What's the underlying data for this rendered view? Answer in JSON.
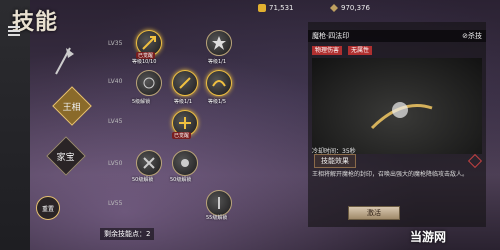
{
  "window": {
    "title": "技能"
  },
  "currency": {
    "coins": "71,531",
    "gems": "970,376"
  },
  "categories": [
    {
      "label": "王相"
    },
    {
      "label": "家宝"
    },
    {
      "label": "重置"
    }
  ],
  "level_labels": [
    "LV35",
    "LV40",
    "LV45",
    "LV50",
    "LV55"
  ],
  "nodes": [
    {
      "sub": "等级10/10",
      "chip": "已觉醒"
    },
    {
      "sub": "等级1/1",
      "chip": ""
    },
    {
      "sub": "5级解锁",
      "chip": ""
    },
    {
      "sub": "等级1/1",
      "chip": ""
    },
    {
      "sub": "等级1/5",
      "chip": ""
    },
    {
      "sub": "",
      "chip": "已觉醒"
    },
    {
      "sub": "50级解锁",
      "chip": ""
    },
    {
      "sub": "50级解锁",
      "chip": ""
    },
    {
      "sub": "55级解锁",
      "chip": ""
    }
  ],
  "skill": {
    "name": "魔枪·四法印",
    "kind": "⊘杀技",
    "tags": [
      "物理伤害",
      "无属性"
    ],
    "cooldown": "冷却时间：35秒",
    "effect_title": "技能效果",
    "effect_text": "王相将解开魔枪的封印，召唤出强大的魔枪降临攻击敌人。",
    "activate_label": "激活"
  },
  "status_text": "剩余技能点：2",
  "watermark": "当游网"
}
